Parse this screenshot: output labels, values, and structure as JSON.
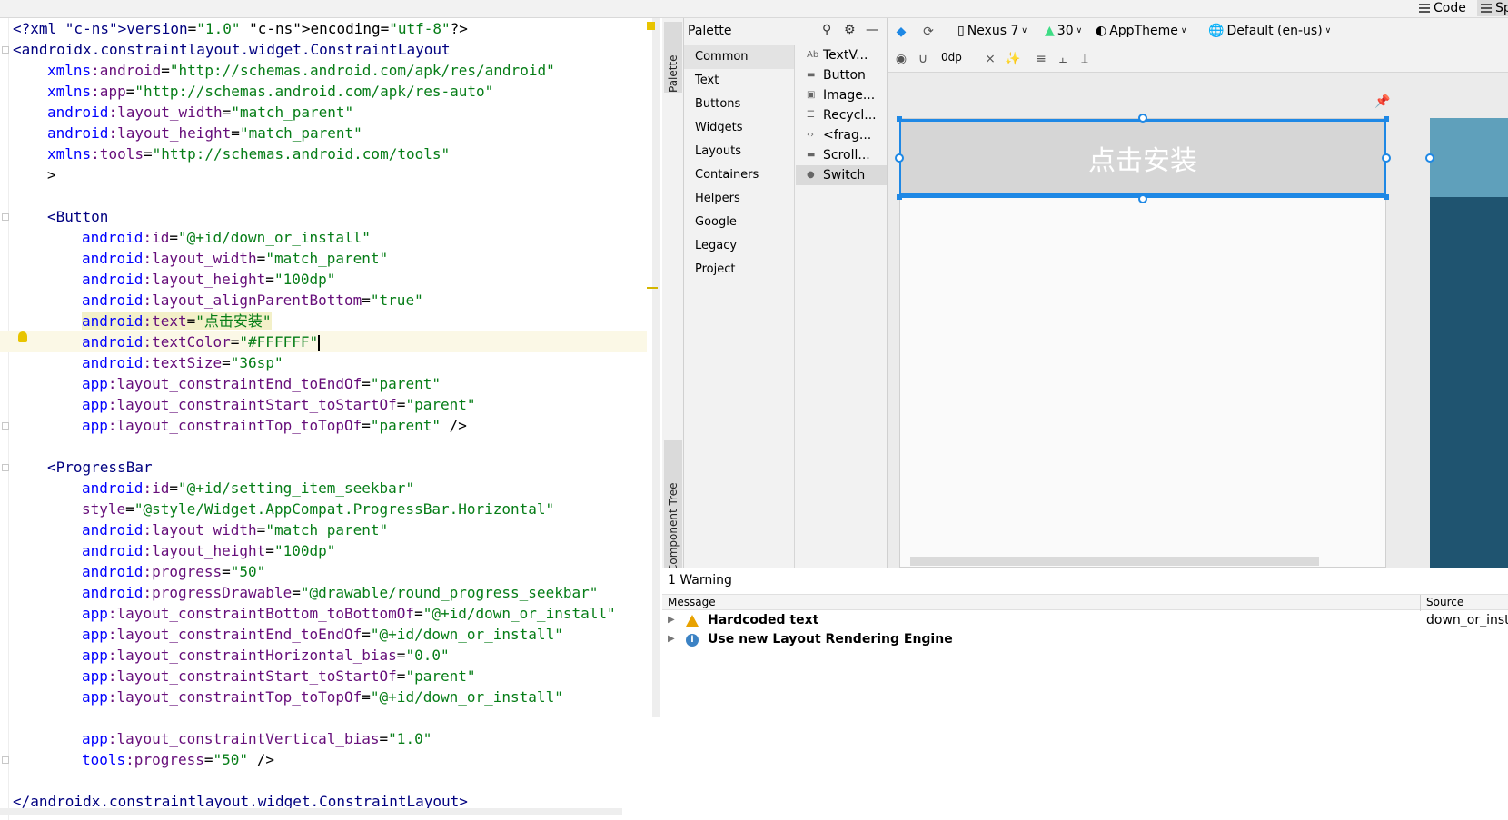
{
  "view_modes": {
    "code": "Code",
    "split": "Sp"
  },
  "code_lines": [
    {
      "t": "pi",
      "text": "<?xml version=\"1.0\" encoding=\"utf-8\"?>"
    },
    {
      "t": "tag",
      "text": "<androidx.constraintlayout.widget.ConstraintLayout"
    },
    {
      "t": "attr",
      "indent": 1,
      "ns": "xmlns:android",
      "val": "\"http://schemas.android.com/apk/res/android\""
    },
    {
      "t": "attr",
      "indent": 1,
      "ns": "xmlns:app",
      "val": "\"http://schemas.android.com/apk/res-auto\""
    },
    {
      "t": "attr",
      "indent": 1,
      "ns": "android:layout_width",
      "val": "\"match_parent\""
    },
    {
      "t": "attr",
      "indent": 1,
      "ns": "android:layout_height",
      "val": "\"match_parent\""
    },
    {
      "t": "attr",
      "indent": 1,
      "ns": "xmlns:tools",
      "val": "\"http://schemas.android.com/tools\""
    },
    {
      "t": "plain",
      "indent": 1,
      "text": ">"
    },
    {
      "t": "blank"
    },
    {
      "t": "tag",
      "indent": 1,
      "text": "<Button"
    },
    {
      "t": "attr",
      "indent": 2,
      "ns": "android:id",
      "val": "\"@+id/down_or_install\""
    },
    {
      "t": "attr",
      "indent": 2,
      "ns": "android:layout_width",
      "val": "\"match_parent\""
    },
    {
      "t": "attr",
      "indent": 2,
      "ns": "android:layout_height",
      "val": "\"100dp\""
    },
    {
      "t": "attr",
      "indent": 2,
      "ns": "android:layout_alignParentBottom",
      "val": "\"true\""
    },
    {
      "t": "attr",
      "indent": 2,
      "ns": "android:text",
      "val": "\"点击安装\"",
      "hilite": true
    },
    {
      "t": "attr",
      "indent": 2,
      "ns": "android:textColor",
      "val": "\"#FFFFFF\"",
      "current": true
    },
    {
      "t": "attr",
      "indent": 2,
      "ns": "android:textSize",
      "val": "\"36sp\""
    },
    {
      "t": "attr",
      "indent": 2,
      "ns": "app:layout_constraintEnd_toEndOf",
      "val": "\"parent\""
    },
    {
      "t": "attr",
      "indent": 2,
      "ns": "app:layout_constraintStart_toStartOf",
      "val": "\"parent\""
    },
    {
      "t": "attr",
      "indent": 2,
      "ns": "app:layout_constraintTop_toTopOf",
      "val": "\"parent\"",
      "tail": " />"
    },
    {
      "t": "blank"
    },
    {
      "t": "tag",
      "indent": 1,
      "text": "<ProgressBar"
    },
    {
      "t": "attr",
      "indent": 2,
      "ns": "android:id",
      "val": "\"@+id/setting_item_seekbar\""
    },
    {
      "t": "attr",
      "indent": 2,
      "ns": "style",
      "val": "\"@style/Widget.AppCompat.ProgressBar.Horizontal\""
    },
    {
      "t": "attr",
      "indent": 2,
      "ns": "android:layout_width",
      "val": "\"match_parent\""
    },
    {
      "t": "attr",
      "indent": 2,
      "ns": "android:layout_height",
      "val": "\"100dp\""
    },
    {
      "t": "attr",
      "indent": 2,
      "ns": "android:progress",
      "val": "\"50\""
    },
    {
      "t": "attr",
      "indent": 2,
      "ns": "android:progressDrawable",
      "val": "\"@drawable/round_progress_seekbar\""
    },
    {
      "t": "attr",
      "indent": 2,
      "ns": "app:layout_constraintBottom_toBottomOf",
      "val": "\"@+id/down_or_install\""
    },
    {
      "t": "attr",
      "indent": 2,
      "ns": "app:layout_constraintEnd_toEndOf",
      "val": "\"@+id/down_or_install\""
    },
    {
      "t": "attr",
      "indent": 2,
      "ns": "app:layout_constraintHorizontal_bias",
      "val": "\"0.0\""
    },
    {
      "t": "attr",
      "indent": 2,
      "ns": "app:layout_constraintStart_toStartOf",
      "val": "\"parent\""
    },
    {
      "t": "attr",
      "indent": 2,
      "ns": "app:layout_constraintTop_toTopOf",
      "val": "\"@+id/down_or_install\""
    },
    {
      "t": "blank"
    },
    {
      "t": "attr",
      "indent": 2,
      "ns": "app:layout_constraintVertical_bias",
      "val": "\"1.0\""
    },
    {
      "t": "attr",
      "indent": 2,
      "ns": "tools:progress",
      "val": "\"50\"",
      "tail": " />"
    },
    {
      "t": "blank"
    },
    {
      "t": "tag",
      "text": "</androidx.constraintlayout.widget.ConstraintLayout>"
    }
  ],
  "palette": {
    "title": "Palette",
    "categories": [
      "Common",
      "Text",
      "Buttons",
      "Widgets",
      "Layouts",
      "Containers",
      "Helpers",
      "Google",
      "Legacy",
      "Project"
    ],
    "selected_category": "Common",
    "widgets": [
      "TextV...",
      "Button",
      "Image...",
      "Recycl...",
      "<frag...",
      "Scroll...",
      "Switch"
    ],
    "selected_widget": "Switch"
  },
  "side_tabs": {
    "palette": "Palette",
    "component_tree": "Component Tree"
  },
  "toolbar": {
    "device": "Nexus 7",
    "api": "30",
    "theme": "AppTheme",
    "locale": "Default (en-us)",
    "margin": "0dp"
  },
  "preview": {
    "button_text": "点击安装"
  },
  "issues": {
    "title": "1 Warning",
    "col_message": "Message",
    "col_source": "Source",
    "rows": [
      {
        "type": "warning",
        "message": "Hardcoded text",
        "source": "down_or_install"
      },
      {
        "type": "info",
        "message": "Use new Layout Rendering Engine",
        "source": ""
      }
    ]
  },
  "colors": {
    "selection": "#1e88e5",
    "blueprint": "#1f5470",
    "warning": "#e8a200",
    "info": "#3b82c4"
  }
}
